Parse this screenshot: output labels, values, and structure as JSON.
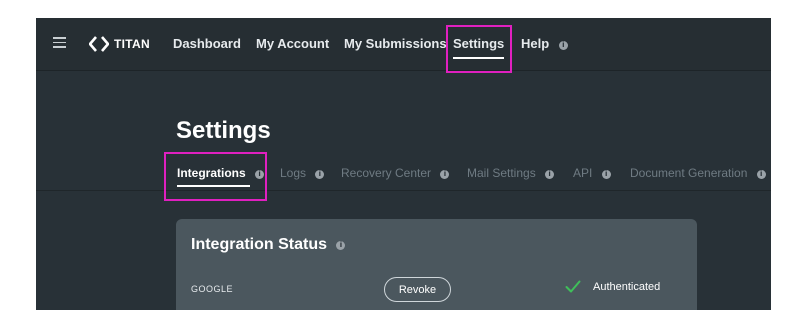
{
  "brand": {
    "name": "TITAN"
  },
  "nav": {
    "items": [
      {
        "label": "Dashboard"
      },
      {
        "label": "My Account"
      },
      {
        "label": "My Submissions"
      },
      {
        "label": "Settings",
        "active": true
      },
      {
        "label": "Help",
        "icon": "info-icon"
      }
    ]
  },
  "page": {
    "title": "Settings"
  },
  "tabs": [
    {
      "label": "Integrations",
      "active": true,
      "icon": "info-icon"
    },
    {
      "label": "Logs",
      "icon": "info-icon"
    },
    {
      "label": "Recovery Center",
      "icon": "info-icon"
    },
    {
      "label": "Mail Settings",
      "icon": "info-icon"
    },
    {
      "label": "API",
      "icon": "info-icon"
    },
    {
      "label": "Document Generation",
      "icon": "info-icon"
    }
  ],
  "integration": {
    "title": "Integration Status",
    "provider": "GOOGLE",
    "revoke_label": "Revoke",
    "status": "Authenticated"
  },
  "colors": {
    "background": "#283137",
    "card": "#4b575e",
    "highlight": "#e020c0",
    "success": "#3fbf5a"
  }
}
